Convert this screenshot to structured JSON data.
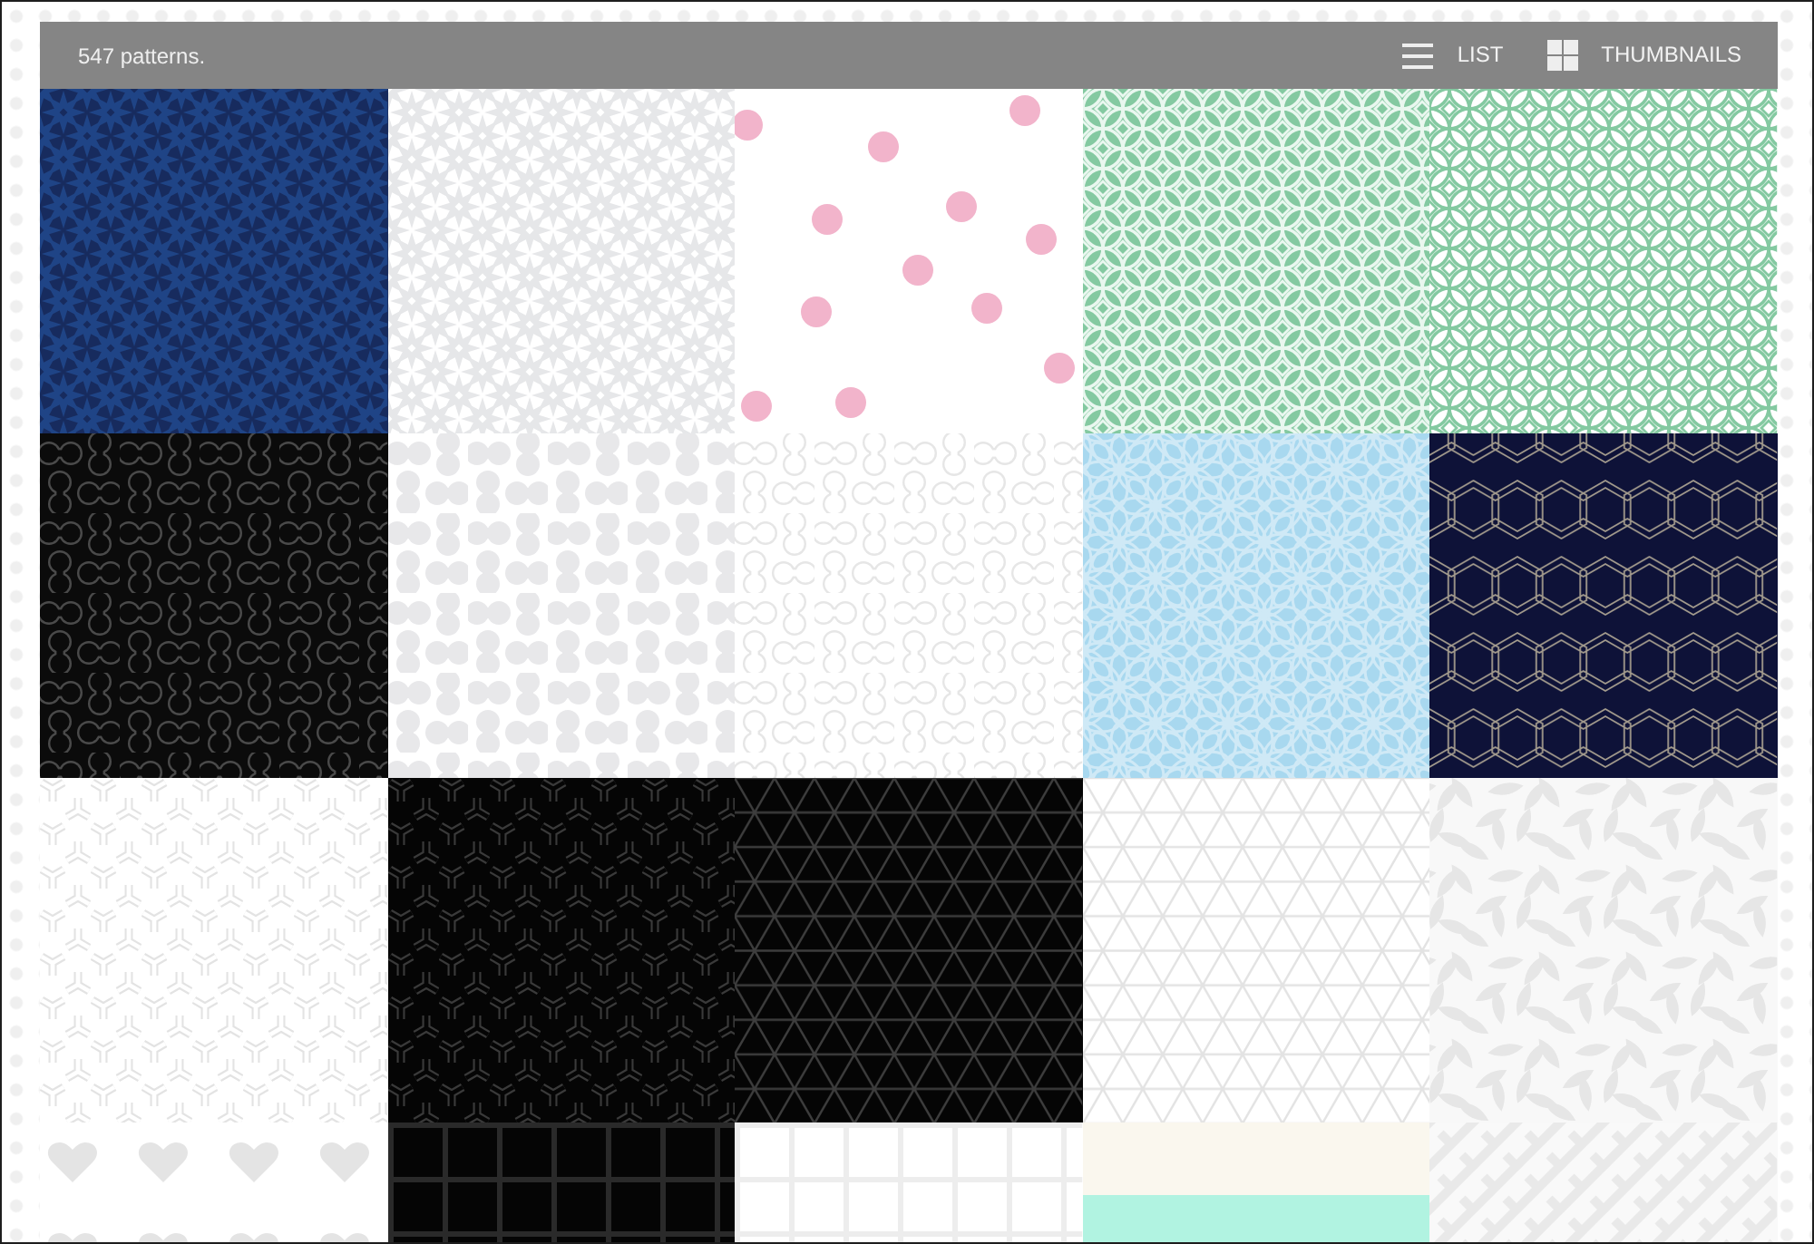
{
  "toolbar": {
    "count": "547 patterns.",
    "views": [
      {
        "kind": "list",
        "label": "LIST"
      },
      {
        "kind": "grid",
        "label": "THUMBNAILS"
      }
    ]
  },
  "patterns": [
    {
      "color": "#172b5e",
      "motif": {
        "kind": "damask",
        "color": "#1f4486"
      }
    },
    {
      "color": "#ffffff",
      "motif": {
        "kind": "damask",
        "color": "#e6e7e9"
      }
    },
    {
      "color": "#ffffff",
      "motif": {
        "kind": "dots",
        "color": "#f2b4cb"
      }
    },
    {
      "color": "#84c9a1",
      "motif": {
        "kind": "rings",
        "color": "#e9f7ef"
      }
    },
    {
      "color": "#ffffff",
      "motif": {
        "kind": "rings",
        "color": "#84c9a1"
      }
    },
    {
      "color": "#0b0b0b",
      "motif": {
        "kind": "loops",
        "color": "#4a4a4a"
      }
    },
    {
      "color": "#ffffff",
      "motif": {
        "kind": "blobs",
        "color": "#e8e8ea"
      }
    },
    {
      "color": "#ffffff",
      "motif": {
        "kind": "loops",
        "color": "#e6e6e6"
      }
    },
    {
      "color": "#a8d8ef",
      "motif": {
        "kind": "floral",
        "color": "#cfe9f6"
      }
    },
    {
      "color": "#0e1238",
      "motif": {
        "kind": "hexagons",
        "color": "#a39b8d"
      }
    },
    {
      "color": "#ffffff",
      "motif": {
        "kind": "tripods",
        "color": "#e3e3e3"
      }
    },
    {
      "color": "#050505",
      "motif": {
        "kind": "tripods",
        "color": "#3a3a3a"
      }
    },
    {
      "color": "#050505",
      "motif": {
        "kind": "triangles",
        "color": "#3d3d3d"
      }
    },
    {
      "color": "#ffffff",
      "motif": {
        "kind": "triangles",
        "color": "#e3e3e3"
      }
    },
    {
      "color": "#f8f8f8",
      "motif": {
        "kind": "leaves",
        "color": "#e6e6e6"
      }
    },
    {
      "color": "#ffffff",
      "motif": {
        "kind": "hearts",
        "color": "#e4e4e4"
      }
    },
    {
      "color": "#050505",
      "motif": {
        "kind": "grid",
        "color": "#2a2a2a"
      }
    },
    {
      "color": "#ffffff",
      "motif": {
        "kind": "grid",
        "color": "#ededed"
      }
    },
    {
      "color": "#faf7ee",
      "motif": {
        "kind": "stripes",
        "color": "#b1f3e1"
      }
    },
    {
      "color": "#f9f9f9",
      "motif": {
        "kind": "zigzag",
        "color": "#e9e9e9"
      }
    }
  ]
}
